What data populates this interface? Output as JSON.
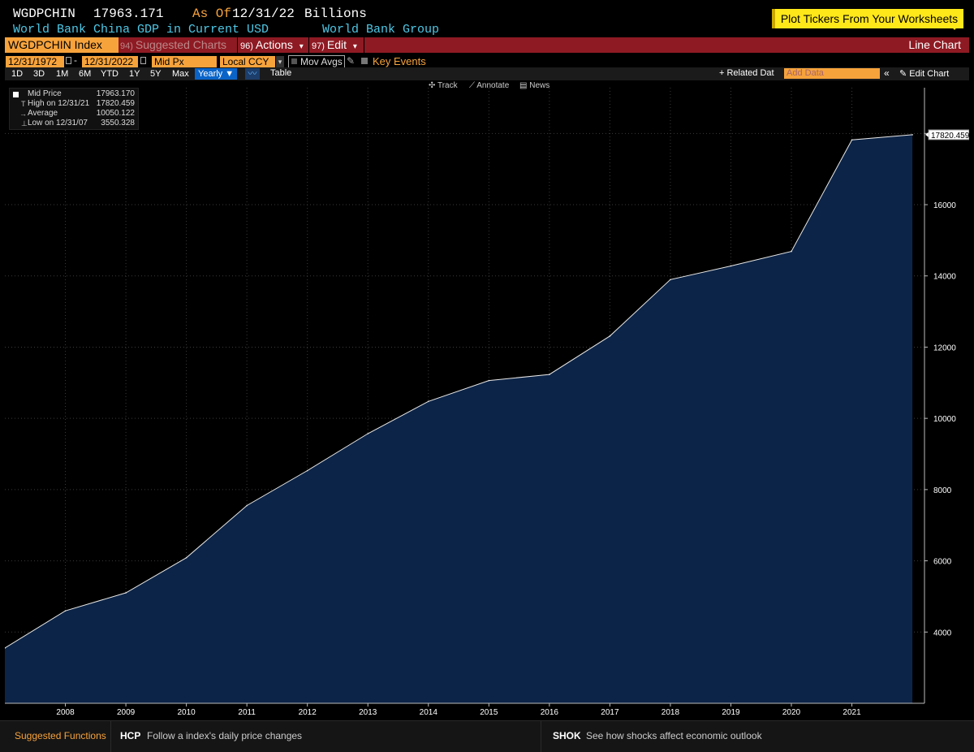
{
  "header": {
    "ticker": "WGDPCHIN",
    "last_value": "17963.171",
    "as_of_label": "As Of",
    "as_of_date": "12/31/22",
    "units": "Billions",
    "description": "World Bank China GDP in Current USD",
    "source": "World Bank Group",
    "plot_tickers": "Plot Tickers From Your Worksheets"
  },
  "toolbar": {
    "security": "WGDPCHIN Index",
    "suggested_num": "94)",
    "suggested_label": "Suggested Charts",
    "actions_num": "96)",
    "actions_label": "Actions",
    "actions_arrow": "▾",
    "edit_num": "97)",
    "edit_label": "Edit",
    "edit_arrow": "▾",
    "chart_type": "Line Chart"
  },
  "controls": {
    "start_date": "12/31/1972",
    "end_date": "12/31/2022",
    "dash": "-",
    "price_type": "Mid Px",
    "currency": "Local CCY",
    "currency_arrow": "▾",
    "mov_avgs": "Mov Avgs",
    "key_events": "Key Events"
  },
  "periods": {
    "items": [
      "1D",
      "3D",
      "1M",
      "6M",
      "YTD",
      "1Y",
      "5Y",
      "Max"
    ],
    "frequency": "Yearly ▼",
    "table": "Table",
    "related": "+ Related Dat",
    "add_data_placeholder": "Add Data",
    "collapse": "«",
    "edit_chart": "✎ Edit Chart"
  },
  "chart_tools": {
    "track": "✣ Track",
    "annotate": "⟋ Annotate",
    "news": "▤ News"
  },
  "legend": {
    "rows": [
      {
        "icon": "",
        "label": "Mid Price",
        "value": "17963.170"
      },
      {
        "icon": "T",
        "label": "High on 12/31/21",
        "value": "17820.459"
      },
      {
        "icon": "→",
        "label": "Average",
        "value": "10050.122"
      },
      {
        "icon": "⊥",
        "label": "Low on 12/31/07",
        "value": "3550.328"
      }
    ]
  },
  "colors": {
    "background": "#000000",
    "area_fill": "#0c2447",
    "line": "#e8e8e8",
    "accent_orange": "#f7a33c",
    "title_cyan": "#4fc8e6",
    "toolbar_red": "#8e1a23"
  },
  "chart_data": {
    "type": "area",
    "x": [
      2007,
      2008,
      2009,
      2010,
      2011,
      2012,
      2013,
      2014,
      2015,
      2016,
      2017,
      2018,
      2019,
      2020,
      2021,
      2022
    ],
    "values": [
      3550.328,
      4594.3,
      5101.7,
      6087.2,
      7551.5,
      8532.2,
      9570.4,
      10475.7,
      11061.6,
      11233.3,
      12310.4,
      13894.8,
      14279.9,
      14687.7,
      17820.459,
      17963.17
    ],
    "xticks": [
      "2008",
      "2009",
      "2010",
      "2011",
      "2012",
      "2013",
      "2014",
      "2015",
      "2016",
      "2017",
      "2018",
      "2019",
      "2020",
      "2021"
    ],
    "yticks": [
      4000,
      6000,
      8000,
      10000,
      12000,
      14000,
      16000,
      18000
    ],
    "ylim": [
      2000,
      18600
    ],
    "last_label": "17820.459",
    "grid": true
  }
}
